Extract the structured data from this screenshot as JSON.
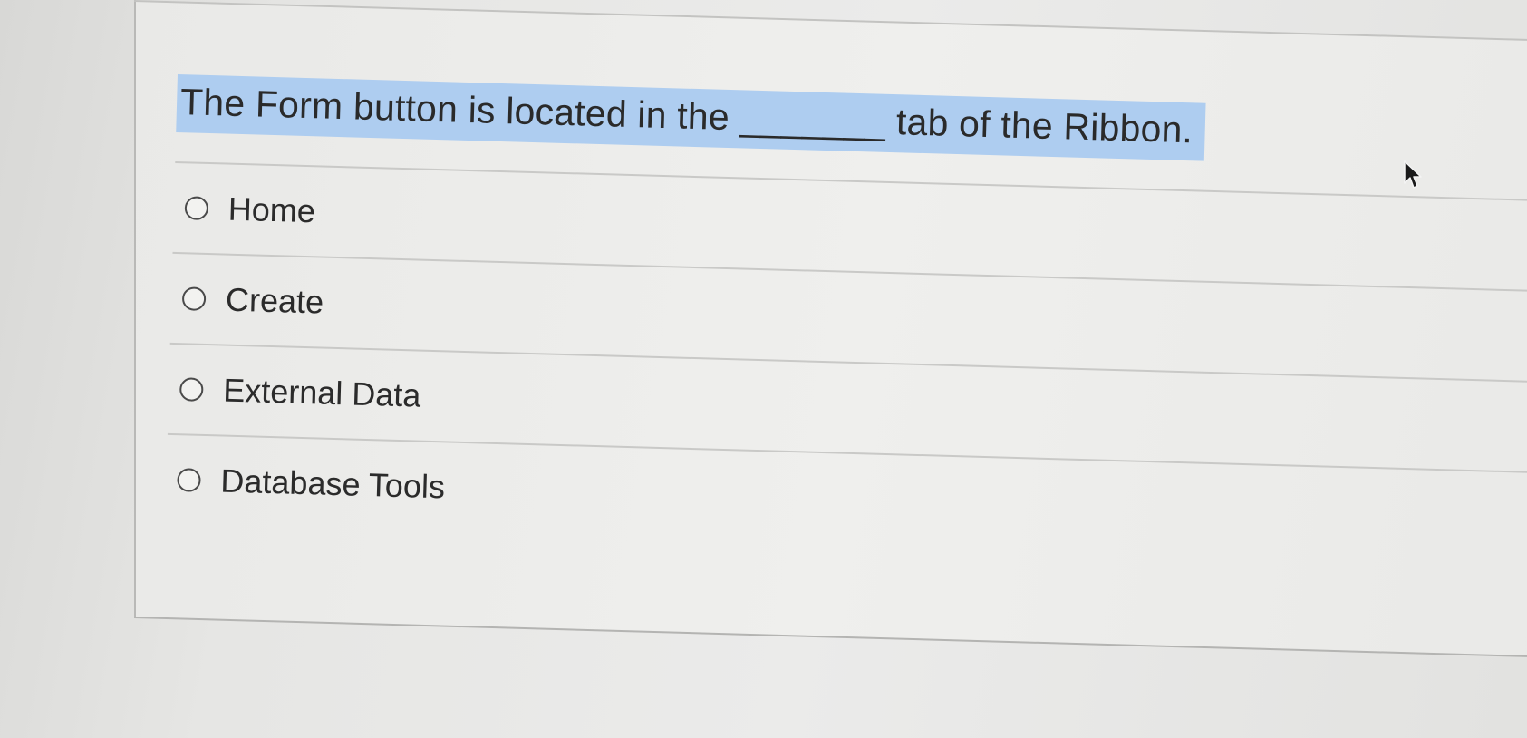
{
  "question": {
    "text": "The Form button is located in the _______ tab of the Ribbon."
  },
  "options": [
    {
      "label": "Home",
      "selected": false
    },
    {
      "label": "Create",
      "selected": false
    },
    {
      "label": "External Data",
      "selected": false
    },
    {
      "label": "Database Tools",
      "selected": false
    }
  ],
  "colors": {
    "highlight": "#aecdf0",
    "background": "#ebebea",
    "text": "#2a2a2a"
  },
  "icons": {
    "cursor": "mouse-pointer-icon",
    "radio": "radio-circle-icon"
  }
}
